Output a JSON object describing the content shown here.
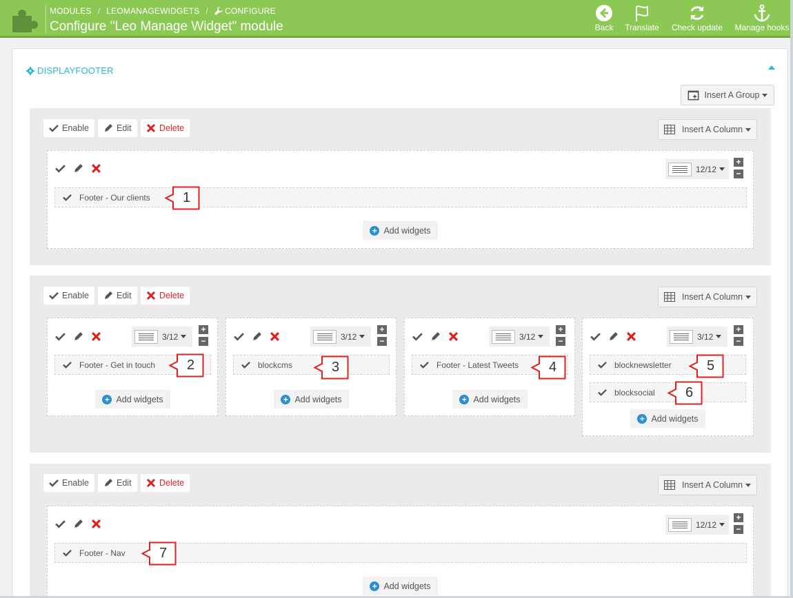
{
  "header": {
    "breadcrumb": [
      "MODULES",
      "LEOMANAGEWIDGETS",
      "CONFIGURE"
    ],
    "title": "Configure \"Leo Manage Widget\" module",
    "toolbar": [
      {
        "label": "Back",
        "icon": "back-arrow-icon"
      },
      {
        "label": "Translate",
        "icon": "flag-icon"
      },
      {
        "label": "Check update",
        "icon": "refresh-icon"
      },
      {
        "label": "Manage hooks",
        "icon": "anchor-icon"
      }
    ]
  },
  "hook": {
    "name": "DISPLAYFOOTER",
    "insert_group_label": "Insert A Group"
  },
  "group_actions": {
    "enable": "Enable",
    "edit": "Edit",
    "delete": "Delete",
    "insert_column": "Insert A Column"
  },
  "add_widgets_label": "Add widgets",
  "groups": [
    {
      "columns": [
        {
          "size": "12/12",
          "widgets": [
            {
              "name": "Footer - Our clients",
              "callout": "1"
            }
          ]
        }
      ]
    },
    {
      "columns": [
        {
          "size": "3/12",
          "widgets": [
            {
              "name": "Footer - Get in touch",
              "callout": "2"
            }
          ]
        },
        {
          "size": "3/12",
          "widgets": [
            {
              "name": "blockcms",
              "callout": "3"
            }
          ]
        },
        {
          "size": "3/12",
          "widgets": [
            {
              "name": "Footer - Latest Tweets",
              "callout": "4"
            }
          ]
        },
        {
          "size": "3/12",
          "widgets": [
            {
              "name": "blocknewsletter",
              "callout": "5"
            },
            {
              "name": "blocksocial",
              "callout": "6"
            }
          ]
        }
      ]
    },
    {
      "columns": [
        {
          "size": "12/12",
          "widgets": [
            {
              "name": "Footer - Nav",
              "callout": "7"
            }
          ]
        }
      ]
    }
  ],
  "colors": {
    "header_green": "#8bc954",
    "accent_blue": "#25b9d7",
    "delete_red": "#e0201f",
    "callout_red": "#e0201f"
  }
}
